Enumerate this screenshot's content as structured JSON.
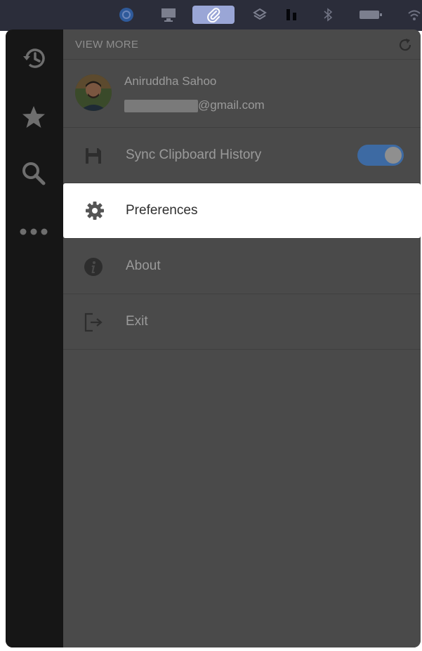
{
  "header": {
    "view_more_label": "VIEW MORE"
  },
  "account": {
    "name": "Aniruddha Sahoo",
    "email_suffix": "@gmail.com"
  },
  "menu": {
    "sync": {
      "label": "Sync Clipboard History",
      "enabled": true
    },
    "preferences": {
      "label": "Preferences"
    },
    "about": {
      "label": "About"
    },
    "exit": {
      "label": "Exit"
    }
  },
  "icons": {
    "rail": [
      "history-icon",
      "star-icon",
      "search-icon",
      "more-icon"
    ],
    "row": [
      "floppy-disk-icon",
      "gear-icon",
      "info-icon",
      "exit-icon"
    ],
    "menubar": [
      "app-icon",
      "display-icon",
      "paperclip-icon",
      "layers-icon",
      "bars-icon",
      "bluetooth-icon",
      "battery-icon",
      "wifi-icon"
    ]
  },
  "colors": {
    "accent_toggle": "#3d6aa3",
    "panel_bg": "#4a4a4a",
    "rail_bg": "#161616",
    "highlight_bg": "#ffffff"
  }
}
